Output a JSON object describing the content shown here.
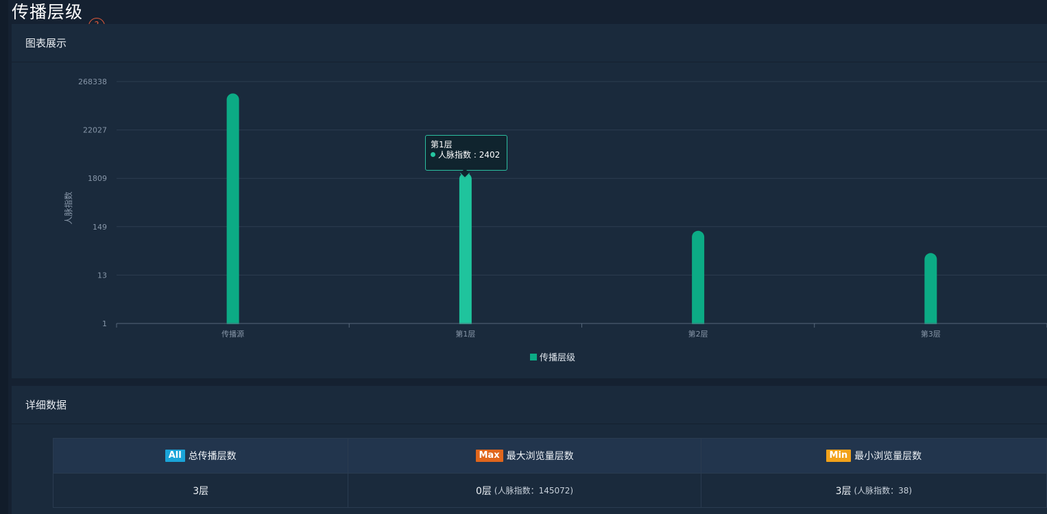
{
  "page": {
    "title": "传播层级"
  },
  "help_icon": "question-circle-icon",
  "chart_panel": {
    "title": "图表展示"
  },
  "chart_data": {
    "type": "bar",
    "categories": [
      "传播源",
      "第1层",
      "第2层",
      "第3层"
    ],
    "series": [
      {
        "name": "传播层级",
        "values": [
          145072,
          2402,
          120,
          38
        ],
        "color": "#0cab85"
      }
    ],
    "ylabel": "人脉指数",
    "xlabel": "",
    "yscale": "log",
    "yticks": [
      "1",
      "13",
      "149",
      "1809",
      "22027",
      "268338"
    ],
    "ylim": [
      1,
      268338
    ],
    "grid": true,
    "legend": "bottom-center",
    "highlight_color": "#1fc49d"
  },
  "tooltip": {
    "title": "第1层",
    "label": "人脉指数",
    "value_text": "2402"
  },
  "detail_panel": {
    "title": "详细数据",
    "columns": [
      {
        "badge": "All",
        "badge_color": "#1aa4d8",
        "label": "总传播层数",
        "value": "3层",
        "sub": ""
      },
      {
        "badge": "Max",
        "badge_color": "#e0661c",
        "label": "最大浏览量层数",
        "value": "0层",
        "sub": "(人脉指数：145072)"
      },
      {
        "badge": "Min",
        "badge_color": "#f2a21a",
        "label": "最小浏览量层数",
        "value": "3层",
        "sub": "(人脉指数：38)"
      }
    ]
  }
}
